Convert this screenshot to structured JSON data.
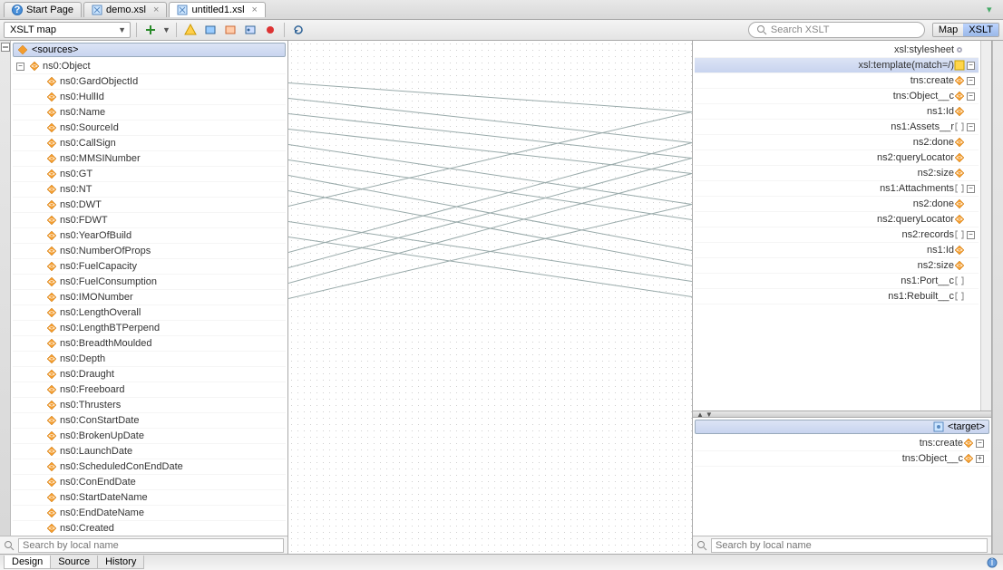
{
  "tabs": [
    {
      "label": "Start Page",
      "active": false,
      "closable": false,
      "icon": "help"
    },
    {
      "label": "demo.xsl",
      "active": false,
      "closable": true,
      "icon": "xsl"
    },
    {
      "label": "untitled1.xsl",
      "active": true,
      "closable": true,
      "icon": "xsl"
    }
  ],
  "toolbar": {
    "combo_label": "XSLT map",
    "search_placeholder": "Search XSLT",
    "toggle": {
      "left": "Map",
      "right": "XSLT",
      "active": "XSLT"
    }
  },
  "source": {
    "header": "<sources>",
    "search_placeholder": "Search by local name",
    "root": {
      "label": "ns0:Object",
      "expanded": true,
      "depth": 0,
      "icon": "elem",
      "toggle": "minus"
    },
    "children": [
      "ns0:GardObjectId",
      "ns0:HullId",
      "ns0:Name",
      "ns0:SourceId",
      "ns0:CallSign",
      "ns0:MMSINumber",
      "ns0:GT",
      "ns0:NT",
      "ns0:DWT",
      "ns0:FDWT",
      "ns0:YearOfBuild",
      "ns0:NumberOfProps",
      "ns0:FuelCapacity",
      "ns0:FuelConsumption",
      "ns0:IMONumber",
      "ns0:LengthOverall",
      "ns0:LengthBTPerpend",
      "ns0:BreadthMoulded",
      "ns0:Depth",
      "ns0:Draught",
      "ns0:Freeboard",
      "ns0:Thrusters",
      "ns0:ConStartDate",
      "ns0:BrokenUpDate",
      "ns0:LaunchDate",
      "ns0:ScheduledConEndDate",
      "ns0:ConEndDate",
      "ns0:StartDateName",
      "ns0:EndDateName",
      "ns0:Created"
    ]
  },
  "target_top": {
    "rows": [
      {
        "label": "xsl:stylesheet",
        "icon": "gear",
        "toggle": null,
        "depth": 0
      },
      {
        "label": "xsl:template(match=/)",
        "icon": "ysq",
        "toggle": "minus",
        "depth": 0,
        "highlight": true
      },
      {
        "label": "tns:create",
        "icon": "elem",
        "toggle": "minus",
        "depth": 1
      },
      {
        "label": "tns:Object__c",
        "icon": "elem",
        "toggle": "minus",
        "depth": 2
      },
      {
        "label": "ns1:Id",
        "icon": "elem",
        "toggle": null,
        "depth": 3
      },
      {
        "label": "ns1:Assets__r",
        "icon": "brk",
        "toggle": "minus",
        "depth": 3
      },
      {
        "label": "ns2:done",
        "icon": "elem",
        "toggle": null,
        "depth": 4
      },
      {
        "label": "ns2:queryLocator",
        "icon": "elem",
        "toggle": null,
        "depth": 4
      },
      {
        "label": "ns2:size",
        "icon": "elem",
        "toggle": null,
        "depth": 4
      },
      {
        "label": "ns1:Attachments",
        "icon": "brk",
        "toggle": "minus",
        "depth": 3
      },
      {
        "label": "ns2:done",
        "icon": "elem",
        "toggle": null,
        "depth": 4
      },
      {
        "label": "ns2:queryLocator",
        "icon": "elem",
        "toggle": null,
        "depth": 4
      },
      {
        "label": "ns2:records",
        "icon": "brk",
        "toggle": "minus",
        "depth": 4
      },
      {
        "label": "ns1:Id",
        "icon": "elem",
        "toggle": null,
        "depth": 5
      },
      {
        "label": "ns2:size",
        "icon": "elem",
        "toggle": null,
        "depth": 4
      },
      {
        "label": "ns1:Port__c",
        "icon": "brk",
        "toggle": null,
        "depth": 3
      },
      {
        "label": "ns1:Rebuilt__c",
        "icon": "brk",
        "toggle": null,
        "depth": 3
      }
    ]
  },
  "target_bottom": {
    "header": "<target>",
    "search_placeholder": "Search by local name",
    "rows": [
      {
        "label": "tns:create",
        "icon": "elem",
        "toggle": "minus",
        "depth": 0
      },
      {
        "label": "tns:Object__c",
        "icon": "elem",
        "toggle": "plus",
        "depth": 1
      }
    ]
  },
  "mappings": [
    {
      "src": 0,
      "dst": 4
    },
    {
      "src": 1,
      "dst": 6
    },
    {
      "src": 2,
      "dst": 7
    },
    {
      "src": 3,
      "dst": 8
    },
    {
      "src": 4,
      "dst": 10
    },
    {
      "src": 5,
      "dst": 11
    },
    {
      "src": 6,
      "dst": 13
    },
    {
      "src": 7,
      "dst": 14
    },
    {
      "src": 8,
      "dst": 4
    },
    {
      "src": 9,
      "dst": 15
    },
    {
      "src": 10,
      "dst": 16
    },
    {
      "src": 11,
      "dst": 6
    },
    {
      "src": 12,
      "dst": 7
    },
    {
      "src": 13,
      "dst": 8
    },
    {
      "src": 14,
      "dst": 10
    }
  ],
  "bottom_tabs": {
    "items": [
      "Design",
      "Source",
      "History"
    ],
    "active": "Design"
  }
}
